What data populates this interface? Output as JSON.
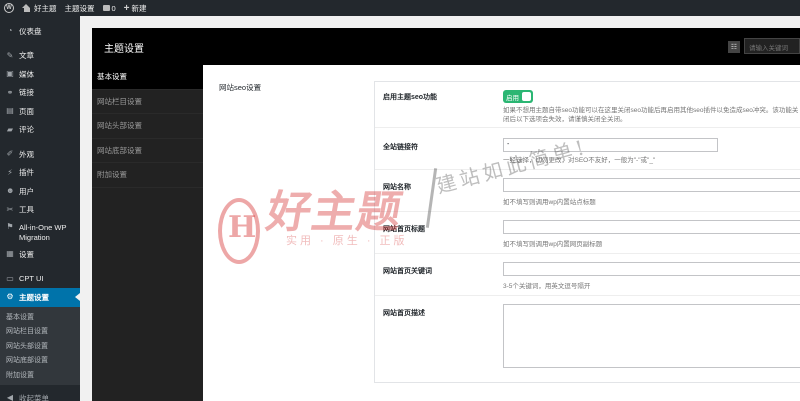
{
  "adminbar": {
    "site_name": "好主题",
    "theme_settings": "主题设置",
    "comments_count": "0",
    "new_label": "新建"
  },
  "sidebar": {
    "items": [
      {
        "label": "仪表盘",
        "icon": "dashboard-icon",
        "glyph": "◔"
      },
      {
        "label": "文章",
        "icon": "pin-icon",
        "glyph": "✎"
      },
      {
        "label": "媒体",
        "icon": "media-icon",
        "glyph": "▣"
      },
      {
        "label": "链接",
        "icon": "link-icon",
        "glyph": "⚭"
      },
      {
        "label": "页面",
        "icon": "page-icon",
        "glyph": "▤"
      },
      {
        "label": "评论",
        "icon": "comment-icon",
        "glyph": "▰"
      },
      {
        "label": "外观",
        "icon": "brush-icon",
        "glyph": "✐"
      },
      {
        "label": "插件",
        "icon": "plugin-icon",
        "glyph": "⚡"
      },
      {
        "label": "用户",
        "icon": "user-icon",
        "glyph": "☻"
      },
      {
        "label": "工具",
        "icon": "wrench-icon",
        "glyph": "✂"
      },
      {
        "label": "All-in-One WP Migration",
        "icon": "migration-icon",
        "glyph": "⚑"
      },
      {
        "label": "设置",
        "icon": "settings-icon",
        "glyph": "▦"
      },
      {
        "label": "CPT UI",
        "icon": "cpt-icon",
        "glyph": "▭"
      },
      {
        "label": "主题设置",
        "icon": "gear-icon",
        "glyph": "⚙"
      }
    ],
    "submenu": [
      "基本设置",
      "网站栏目设置",
      "网站头部设置",
      "网站底部设置",
      "附加设置"
    ],
    "collapse_label": "收起菜单"
  },
  "panel": {
    "title": "主题设置",
    "search_placeholder": "请输入关键词",
    "tabs": [
      "基本设置",
      "网站栏目设置",
      "网站头部设置",
      "网站底部设置",
      "附加设置"
    ],
    "section_label": "网站seo设置"
  },
  "form": {
    "seo_toggle": {
      "label": "启用主题seo功能",
      "state": "启用",
      "hint": "如果不想用主题自带seo功能可以在这里关闭seo功能后再启用其他seo插件以免造成seo冲突。该功能关闭后以下选项会失效，请谨慎关闭全关闭。"
    },
    "separator": {
      "label": "全站链接符",
      "value": "-",
      "hint": "一经选择，切勿更改，对SEO不友好，一般为\"-\"或\"_\""
    },
    "site_name": {
      "label": "网站名称",
      "value": "",
      "hint": "如不填写则调用wp内置站点标题"
    },
    "home_title": {
      "label": "网站首页标题",
      "value": "",
      "hint": "如不填写则调用wp内置网页副标题"
    },
    "home_keywords": {
      "label": "网站首页关键词",
      "value": "",
      "hint": "3-5个关键词，用英文逗号隔开"
    },
    "home_description": {
      "label": "网站首页描述",
      "value": ""
    }
  },
  "watermark": {
    "logo_letter": "H",
    "brand": "好主题",
    "sub": "实用 · 原生 · 正版",
    "slogan": "建站如此简单!"
  },
  "colors": {
    "admin_dark": "#23282d",
    "active_blue": "#0073aa",
    "toggle_green": "#2bb673"
  }
}
